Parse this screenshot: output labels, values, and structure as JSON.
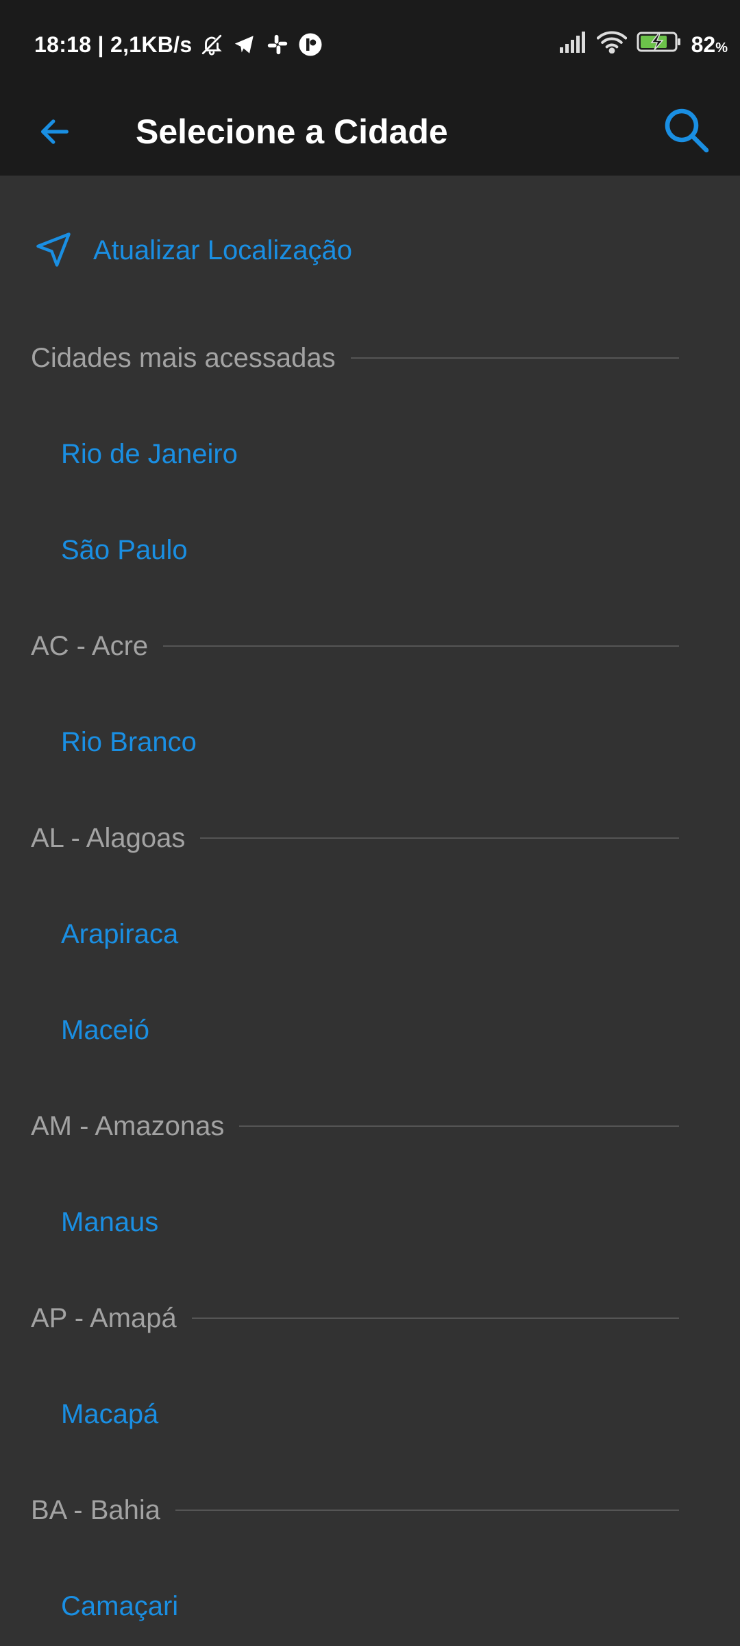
{
  "status_bar": {
    "time_speed": "18:18 | 2,1KB/s",
    "battery_percent": "82",
    "battery_unit": "%",
    "icons": [
      "bell-off-icon",
      "telegram-icon",
      "slack-icon",
      "app-icon",
      "signal-icon",
      "wifi-icon",
      "battery-charging-icon"
    ]
  },
  "header": {
    "title": "Selecione a Cidade",
    "back_icon": "arrow-left-icon",
    "search_icon": "search-icon"
  },
  "location": {
    "label": "Atualizar Localização",
    "icon": "navigation-arrow-icon"
  },
  "sections": [
    {
      "title": "Cidades mais acessadas",
      "cities": [
        "Rio de Janeiro",
        "São Paulo"
      ]
    },
    {
      "title": "AC - Acre",
      "cities": [
        "Rio Branco"
      ]
    },
    {
      "title": "AL - Alagoas",
      "cities": [
        "Arapiraca",
        "Maceió"
      ]
    },
    {
      "title": "AM - Amazonas",
      "cities": [
        "Manaus"
      ]
    },
    {
      "title": "AP - Amapá",
      "cities": [
        "Macapá"
      ]
    },
    {
      "title": "BA - Bahia",
      "cities": [
        "Camaçari"
      ]
    }
  ],
  "colors": {
    "accent": "#1a8fe3",
    "background": "#323232",
    "header_bg": "#1b1b1b",
    "section_text": "#a3a3a3",
    "battery_green": "#6cc24a"
  }
}
